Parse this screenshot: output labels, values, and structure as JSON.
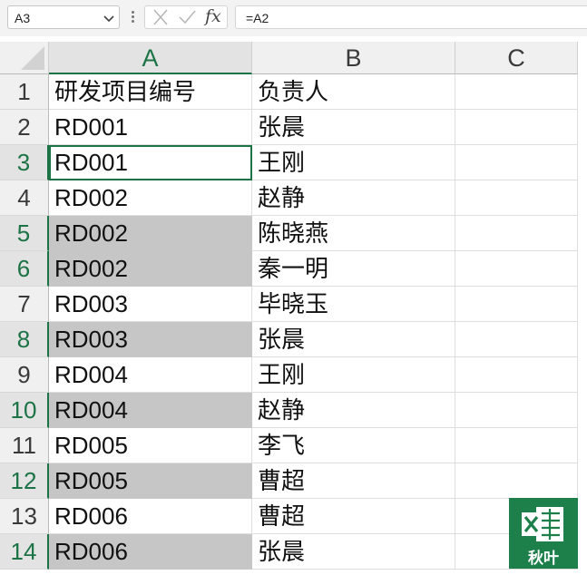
{
  "formula_bar": {
    "name_box": "A3",
    "fx_label": "fx",
    "formula": "=A2"
  },
  "columns": [
    "A",
    "B",
    "C"
  ],
  "active_column": "A",
  "rows": [
    {
      "num": "1",
      "a": "研发项目编号",
      "b": "负责人",
      "a_grey": false
    },
    {
      "num": "2",
      "a": "RD001",
      "b": "张晨",
      "a_grey": false
    },
    {
      "num": "3",
      "a": "RD001",
      "b": "王刚",
      "a_grey": false
    },
    {
      "num": "4",
      "a": "RD002",
      "b": "赵静",
      "a_grey": false
    },
    {
      "num": "5",
      "a": "RD002",
      "b": "陈晓燕",
      "a_grey": true
    },
    {
      "num": "6",
      "a": "RD002",
      "b": "秦一明",
      "a_grey": true
    },
    {
      "num": "7",
      "a": "RD003",
      "b": "毕晓玉",
      "a_grey": false
    },
    {
      "num": "8",
      "a": "RD003",
      "b": "张晨",
      "a_grey": true
    },
    {
      "num": "9",
      "a": "RD004",
      "b": "王刚",
      "a_grey": false
    },
    {
      "num": "10",
      "a": "RD004",
      "b": "赵静",
      "a_grey": true
    },
    {
      "num": "11",
      "a": "RD005",
      "b": "李飞",
      "a_grey": false
    },
    {
      "num": "12",
      "a": "RD005",
      "b": "曹超",
      "a_grey": true
    },
    {
      "num": "13",
      "a": "RD006",
      "b": "曹超",
      "a_grey": false
    },
    {
      "num": "14",
      "a": "RD006",
      "b": "张晨",
      "a_grey": true
    }
  ],
  "active_rows": [
    "3",
    "5",
    "6",
    "8",
    "10",
    "12",
    "14"
  ],
  "selected_cell": "A3",
  "colors": {
    "accent": "#1c7346",
    "grey_fill": "#c6c6c6",
    "logo_bg": "#1d7f4a"
  },
  "logo": {
    "text": "秋叶",
    "icon": "excel-icon"
  }
}
